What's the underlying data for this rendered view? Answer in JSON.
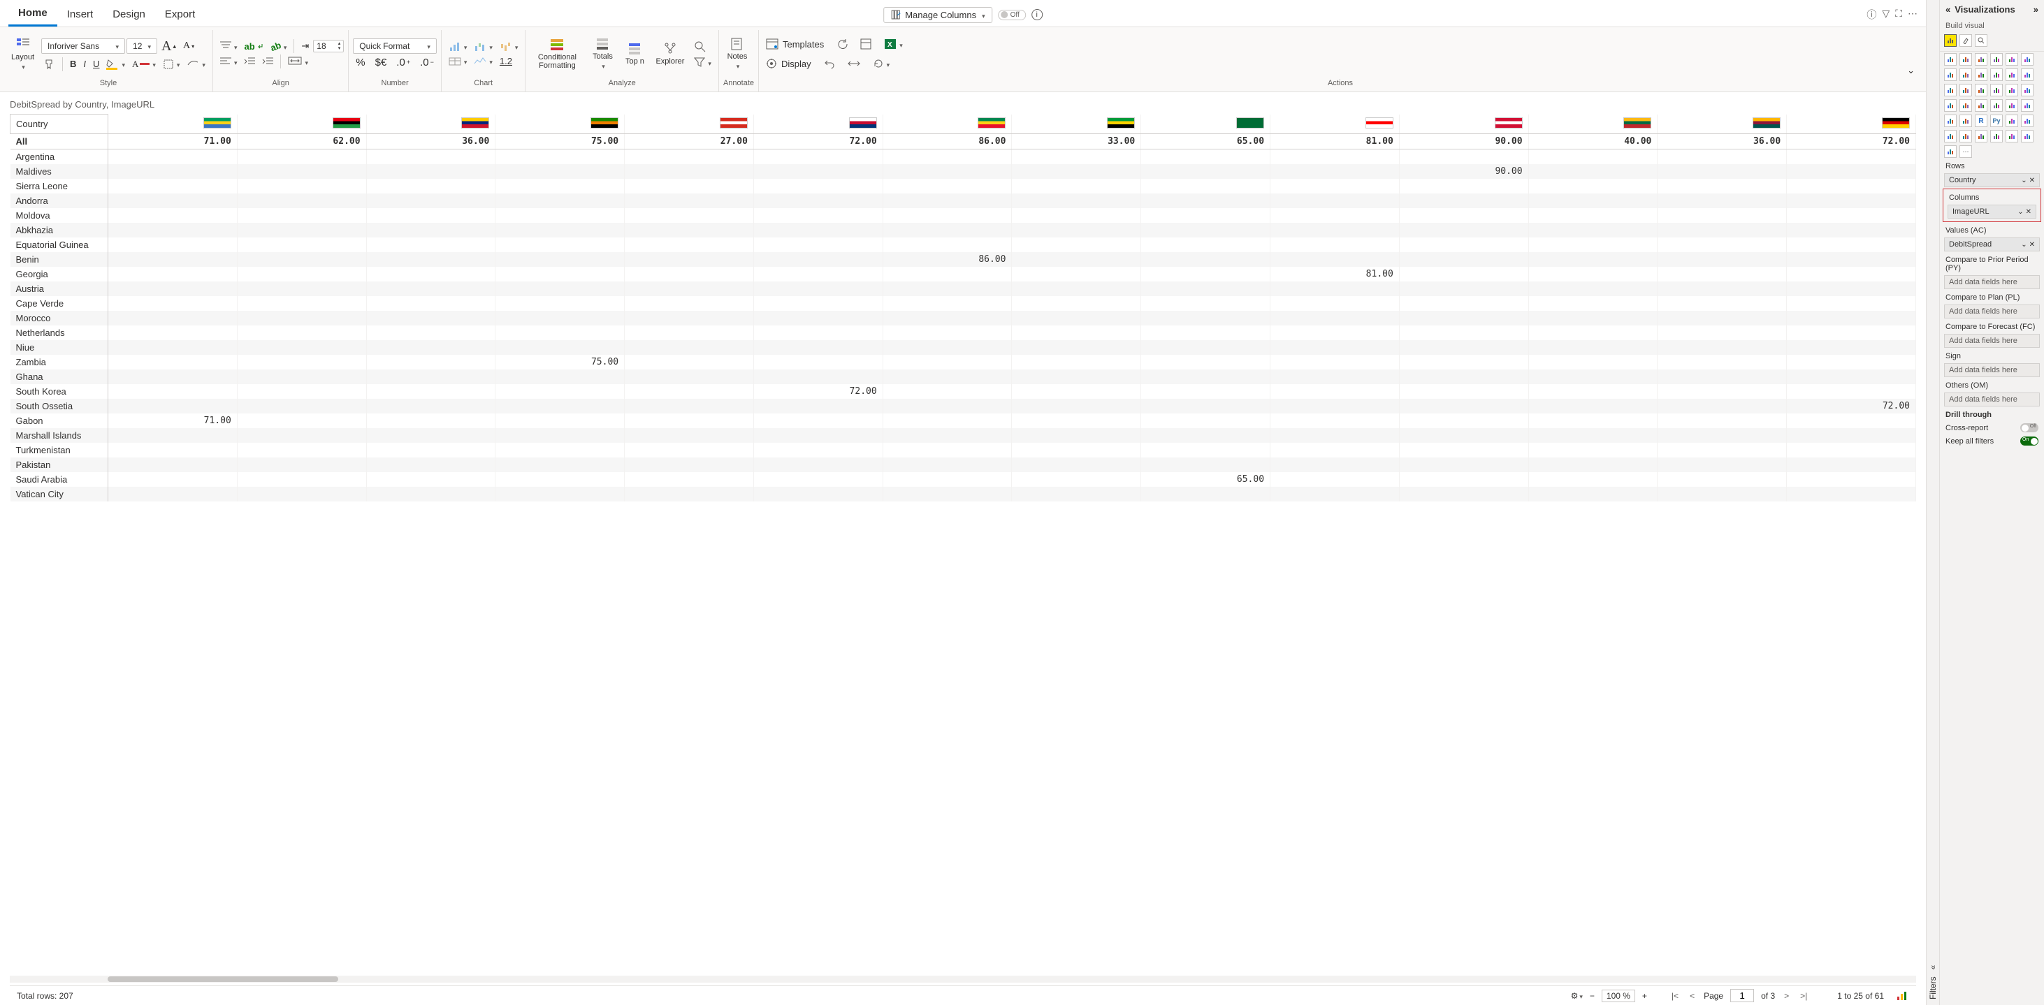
{
  "tabs": {
    "home": "Home",
    "insert": "Insert",
    "design": "Design",
    "export": "Export"
  },
  "topbar": {
    "manage_columns": "Manage Columns",
    "toggle": "Off"
  },
  "ribbon": {
    "layout": "Layout",
    "font_family": "Inforiver Sans",
    "font_size": "12",
    "indent_size": "18",
    "quick_format": "Quick Format",
    "cond_format": "Conditional Formatting",
    "totals": "Totals",
    "topn": "Top n",
    "explorer": "Explorer",
    "notes": "Notes",
    "templates": "Templates",
    "display": "Display",
    "decimals": "1.2",
    "groups": {
      "style": "Style",
      "align": "Align",
      "number": "Number",
      "chart": "Chart",
      "analyze": "Analyze",
      "annotate": "Annotate",
      "actions": "Actions"
    }
  },
  "report_title": "DebitSpread by Country, ImageURL",
  "grid": {
    "col_header": "Country",
    "flag_names": [
      "Gabon",
      "Libya",
      "Venezuela",
      "Zambia",
      "Switzerland",
      "South Korea",
      "Benin",
      "Jamaica",
      "Saudi Arabia",
      "Georgia",
      "Maldives",
      "Lithuania",
      "Sri Lanka",
      "Germany"
    ],
    "all_label": "All",
    "all_values": [
      "71.00",
      "62.00",
      "36.00",
      "75.00",
      "27.00",
      "72.00",
      "86.00",
      "33.00",
      "65.00",
      "81.00",
      "90.00",
      "40.00",
      "36.00",
      "72.00"
    ],
    "rows": [
      {
        "c": "Argentina"
      },
      {
        "c": "Maldives",
        "v": {
          "10": "90.00"
        }
      },
      {
        "c": "Sierra Leone"
      },
      {
        "c": "Andorra"
      },
      {
        "c": "Moldova"
      },
      {
        "c": "Abkhazia"
      },
      {
        "c": "Equatorial Guinea"
      },
      {
        "c": "Benin",
        "v": {
          "6": "86.00"
        }
      },
      {
        "c": "Georgia",
        "v": {
          "9": "81.00"
        }
      },
      {
        "c": "Austria"
      },
      {
        "c": "Cape Verde"
      },
      {
        "c": "Morocco"
      },
      {
        "c": "Netherlands"
      },
      {
        "c": "Niue"
      },
      {
        "c": "Zambia",
        "v": {
          "3": "75.00"
        }
      },
      {
        "c": "Ghana"
      },
      {
        "c": "South Korea",
        "v": {
          "5": "72.00"
        }
      },
      {
        "c": "South Ossetia",
        "v": {
          "13": "72.00"
        }
      },
      {
        "c": "Gabon",
        "v": {
          "0": "71.00"
        }
      },
      {
        "c": "Marshall Islands"
      },
      {
        "c": "Turkmenistan"
      },
      {
        "c": "Pakistan"
      },
      {
        "c": "Saudi Arabia",
        "v": {
          "8": "65.00"
        }
      },
      {
        "c": "Vatican City"
      }
    ]
  },
  "status": {
    "total_rows": "Total rows: 207",
    "zoom": "100 %",
    "page_label": "Page",
    "page_current": "1",
    "page_of": "of 3",
    "range": "1 to 25 of 61"
  },
  "panel": {
    "title": "Visualizations",
    "build": "Build visual",
    "rows_label": "Rows",
    "rows_field": "Country",
    "cols_label": "Columns",
    "cols_field": "ImageURL",
    "values_label": "Values (AC)",
    "values_field": "DebitSpread",
    "py_label": "Compare to Prior Period (PY)",
    "pl_label": "Compare to Plan (PL)",
    "fc_label": "Compare to Forecast (FC)",
    "sign_label": "Sign",
    "om_label": "Others (OM)",
    "placeholder": "Add data fields here",
    "drill": "Drill through",
    "cross": "Cross-report",
    "keep": "Keep all filters",
    "filters": "Filters",
    "off": "Off",
    "on": "On"
  },
  "flag_colors": [
    [
      "#009e60",
      "#fcd116",
      "#3a75c4"
    ],
    [
      "#e70013",
      "#000",
      "#239e46"
    ],
    [
      "#ffcc00",
      "#00247d",
      "#cf142b"
    ],
    [
      "#198a00",
      "#ef7d00",
      "#000"
    ],
    [
      "#d52b1e",
      "#fff",
      "#d52b1e"
    ],
    [
      "#fff",
      "#c60c30",
      "#003478"
    ],
    [
      "#008751",
      "#fcd116",
      "#e8112d"
    ],
    [
      "#009b3a",
      "#fed100",
      "#000"
    ],
    [
      "#006c35",
      "#006c35",
      "#006c35"
    ],
    [
      "#fff",
      "#ff0000",
      "#fff"
    ],
    [
      "#d21034",
      "#fff",
      "#d21034"
    ],
    [
      "#fdb913",
      "#006a44",
      "#c1272d"
    ],
    [
      "#ffb700",
      "#8d153a",
      "#00534e"
    ],
    [
      "#000",
      "#dd0000",
      "#ffce00"
    ]
  ]
}
